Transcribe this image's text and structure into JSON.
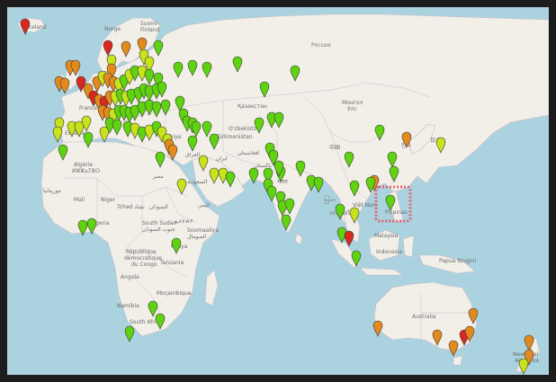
{
  "map": {
    "labels": {
      "iceland": "Iceland",
      "norge": "Norge",
      "suomi": "Suomi -",
      "finland": "Finland",
      "russia": "Россия",
      "kazakhstan": "Қазақстан",
      "mongolia_1": "Монгол",
      "mongolia_2": "Улс",
      "france": "France",
      "espana": "España",
      "turkiye": "Türkiye",
      "turkmenistan": "Türkmenistan",
      "uzbekistan": "O'zbekiston",
      "algerie_1": "Algérie",
      "algerie_2": "ⵍⵣⵣⴰⵢⴻⵔ",
      "mauritania": "موريتانيا",
      "mali": "Mali",
      "niger": "Niger",
      "tchad": "Tchad تشاد",
      "sudan": "السودان",
      "egypt": "مصر",
      "iraq": "العراق",
      "iran": "ایران",
      "saudi": "السعودية",
      "yemen": "اليمن",
      "afghanistan": "افغانستان",
      "pakistan": "پاکستان",
      "india": "भारत",
      "china": "中国",
      "nigeria": "Nigeria",
      "south_sudan_1": "South Sudan",
      "south_sudan_2": "جنوب السودان",
      "ethiopia": "ኢትዮጵያ",
      "soomaaliya_1": "Soomaaliya",
      "soomaaliya_2": "الصومال",
      "kenya": "Kenya",
      "drc_1": "République",
      "drc_2": "démocratique",
      "drc_3": "du Congo",
      "tanzania": "Tanzania",
      "angola": "Angola",
      "namibia": "Namibia",
      "mocambique": "Moçambique",
      "south_africa": "South Africa",
      "myanmar": "မြန်မာ",
      "thailand": "ประเทศไทย",
      "vietnam": "Việt Nam",
      "philippines": "Pilipinas",
      "malaysia": "Malaysia",
      "indonesia": "Indonesia",
      "papua": "Papua Niugini",
      "australia": "Australia",
      "korea": "한국",
      "japan": "日本",
      "new_zealand_1": "New Zeal",
      "new_zealand_2": "Aotearoa"
    },
    "highlight": "Philippines"
  }
}
